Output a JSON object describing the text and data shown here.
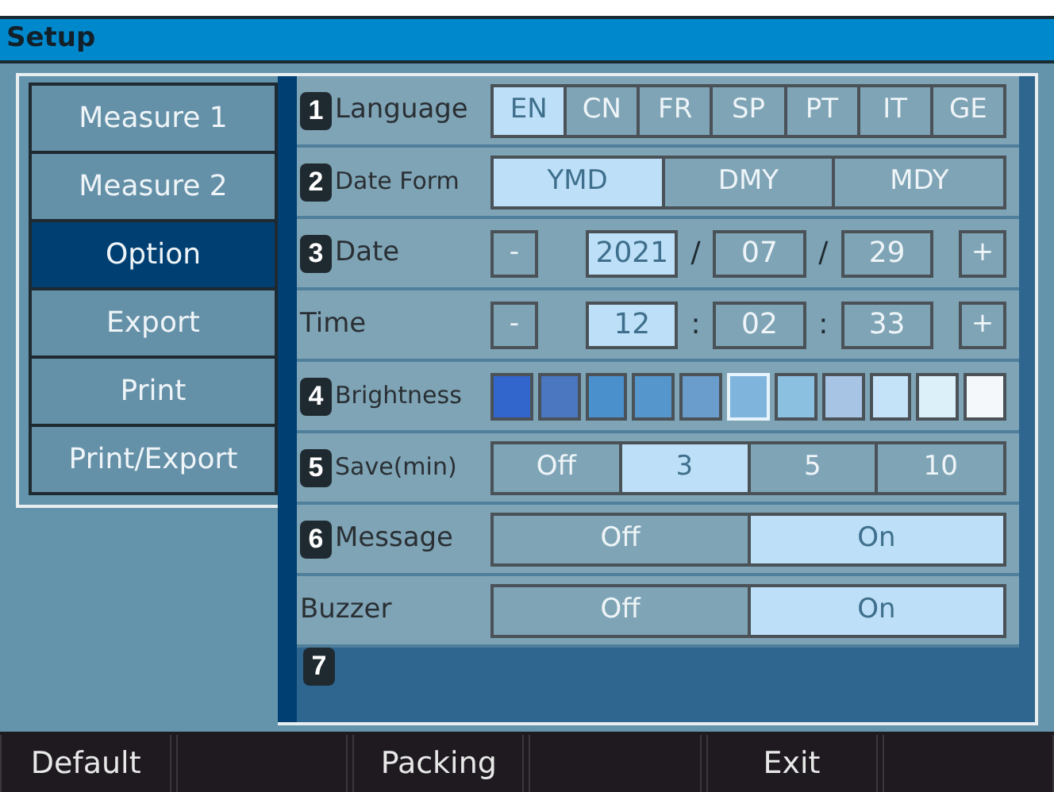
{
  "window": {
    "title": "Setup"
  },
  "tabs": [
    {
      "label": "Measure 1",
      "selected": false
    },
    {
      "label": "Measure 2",
      "selected": false
    },
    {
      "label": "Option",
      "selected": true
    },
    {
      "label": "Export",
      "selected": false
    },
    {
      "label": "Print",
      "selected": false
    },
    {
      "label": "Print/Export",
      "selected": false
    }
  ],
  "rows": [
    {
      "kind": "segmented",
      "callout": "1",
      "label": "Language",
      "options": [
        {
          "label": "EN",
          "selected": true
        },
        {
          "label": "CN",
          "selected": false
        },
        {
          "label": "FR",
          "selected": false
        },
        {
          "label": "SP",
          "selected": false
        },
        {
          "label": "PT",
          "selected": false
        },
        {
          "label": "IT",
          "selected": false
        },
        {
          "label": "GE",
          "selected": false
        }
      ]
    },
    {
      "kind": "segmented",
      "callout": "2",
      "label": "Date Form",
      "options": [
        {
          "label": "YMD",
          "selected": true
        },
        {
          "label": "DMY",
          "selected": false
        },
        {
          "label": "MDY",
          "selected": false
        }
      ]
    },
    {
      "kind": "stepper",
      "callout": "3",
      "label": "Date",
      "minus": "-",
      "plus": "+",
      "fields": [
        {
          "value": "2021",
          "selected": true
        },
        {
          "value": "07",
          "selected": false
        },
        {
          "value": "29",
          "selected": false
        }
      ],
      "separators": [
        "/",
        "/"
      ]
    },
    {
      "kind": "stepper",
      "label": "Time",
      "minus": "-",
      "plus": "+",
      "fields": [
        {
          "value": "12",
          "selected": true
        },
        {
          "value": "02",
          "selected": false
        },
        {
          "value": "33",
          "selected": false
        }
      ],
      "separators": [
        ":",
        ":"
      ]
    },
    {
      "kind": "swatches",
      "callout": "4",
      "label": "Brightness",
      "swatches": [
        {
          "color": "#3366cc",
          "selected": false
        },
        {
          "color": "#4a77c0",
          "selected": false
        },
        {
          "color": "#4a90cc",
          "selected": false
        },
        {
          "color": "#5596cc",
          "selected": false
        },
        {
          "color": "#6a9ccc",
          "selected": false
        },
        {
          "color": "#7fb4dc",
          "selected": true
        },
        {
          "color": "#8cc0e0",
          "selected": false
        },
        {
          "color": "#a8c4e4",
          "selected": false
        },
        {
          "color": "#c4e2f8",
          "selected": false
        },
        {
          "color": "#dcf0fa",
          "selected": false
        },
        {
          "color": "#f4f8fa",
          "selected": false
        }
      ]
    },
    {
      "kind": "segmented",
      "callout": "5",
      "label": "Save(min)",
      "options": [
        {
          "label": "Off",
          "selected": false
        },
        {
          "label": "3",
          "selected": true
        },
        {
          "label": "5",
          "selected": false
        },
        {
          "label": "10",
          "selected": false
        }
      ]
    },
    {
      "kind": "segmented",
      "callout": "6",
      "label": "Message",
      "options": [
        {
          "label": "Off",
          "selected": false
        },
        {
          "label": "On",
          "selected": true
        }
      ]
    },
    {
      "kind": "segmented",
      "label": "Buzzer",
      "options": [
        {
          "label": "Off",
          "selected": false
        },
        {
          "label": "On",
          "selected": true
        }
      ]
    }
  ],
  "trailing_callout": "7",
  "footer": [
    "Default",
    "Packing",
    "Exit"
  ]
}
